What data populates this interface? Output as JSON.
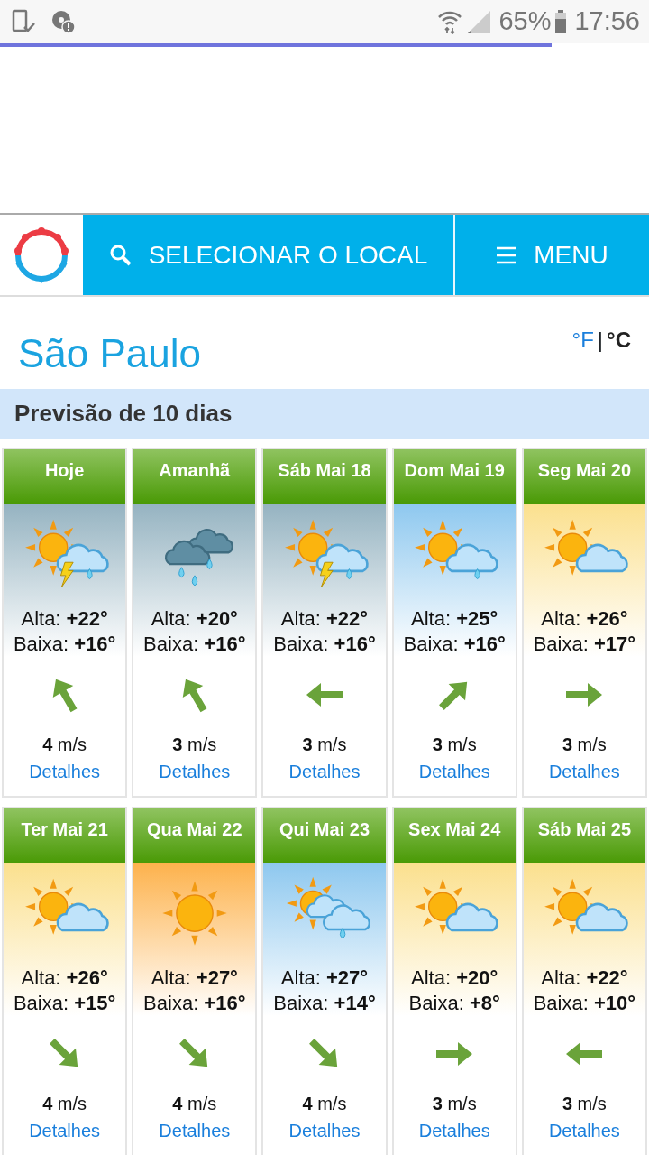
{
  "status_bar": {
    "battery": "65%",
    "time": "17:56"
  },
  "loading_bar": {
    "level": 0.85
  },
  "header": {
    "search_button": "SELECIONAR O LOCAL",
    "menu_button": "MENU"
  },
  "city": "São Paulo",
  "units": [
    {
      "label": "°F",
      "selected": false
    },
    {
      "label": "°C",
      "selected": true
    }
  ],
  "units_separator": "|",
  "section_title": "Previsão de 10 dias",
  "days": [
    {
      "day": "Hoje",
      "kind": "storm",
      "high": "Alta: **+22°**",
      "low": "Baixa: **+16°**",
      "wind_arrow": {
        "kind": "nw"
      },
      "wind": "**4** m/s",
      "link": "Detalhes"
    },
    {
      "day": "Amanhã",
      "kind": "rain",
      "high": "Alta: **+20°**",
      "low": "Baixa: **+16°**",
      "wind_arrow": {
        "kind": "nw"
      },
      "wind": "**3** m/s",
      "link": "Detalhes"
    },
    {
      "day": "Sáb Mai 18",
      "kind": "storm",
      "high": "Alta: **+22°**",
      "low": "Baixa: **+16°**",
      "wind_arrow": {
        "kind": "w"
      },
      "wind": "**3** m/s",
      "link": "Detalhes"
    },
    {
      "day": "Dom Mai 19",
      "kind": "showers",
      "high": "Alta: **+25°**",
      "low": "Baixa: **+16°**",
      "wind_arrow": {
        "kind": "ne"
      },
      "wind": "**3** m/s",
      "link": "Detalhes"
    },
    {
      "day": "Seg Mai 20",
      "kind": "partly",
      "high": "Alta: **+26°**",
      "low": "Baixa: **+17°**",
      "wind_arrow": {
        "kind": "e"
      },
      "wind": "**3** m/s",
      "link": "Detalhes"
    },
    {
      "day": "Ter Mai 21",
      "kind": "partly",
      "high": "Alta: **+26°**",
      "low": "Baixa: **+15°**",
      "wind_arrow": {
        "kind": "se"
      },
      "wind": "**4** m/s",
      "link": "Detalhes"
    },
    {
      "day": "Qua Mai 22",
      "kind": "sunny",
      "high": "Alta: **+27°**",
      "low": "Baixa: **+16°**",
      "wind_arrow": {
        "kind": "se"
      },
      "wind": "**4** m/s",
      "link": "Detalhes"
    },
    {
      "day": "Qui Mai 23",
      "kind": "cloudyshowers",
      "high": "Alta: **+27°**",
      "low": "Baixa: **+14°**",
      "wind_arrow": {
        "kind": "se"
      },
      "wind": "**4** m/s",
      "link": "Detalhes"
    },
    {
      "day": "Sex Mai 24",
      "kind": "partly",
      "high": "Alta: **+20°**",
      "low": "Baixa: **+8°**",
      "wind_arrow": {
        "kind": "e"
      },
      "wind": "**3** m/s",
      "link": "Detalhes"
    },
    {
      "day": "Sáb Mai 25",
      "kind": "partly",
      "high": "Alta: **+22°**",
      "low": "Baixa: **+10°**",
      "wind_arrow": {
        "kind": "w"
      },
      "wind": "**3** m/s",
      "link": "Detalhes"
    }
  ]
}
